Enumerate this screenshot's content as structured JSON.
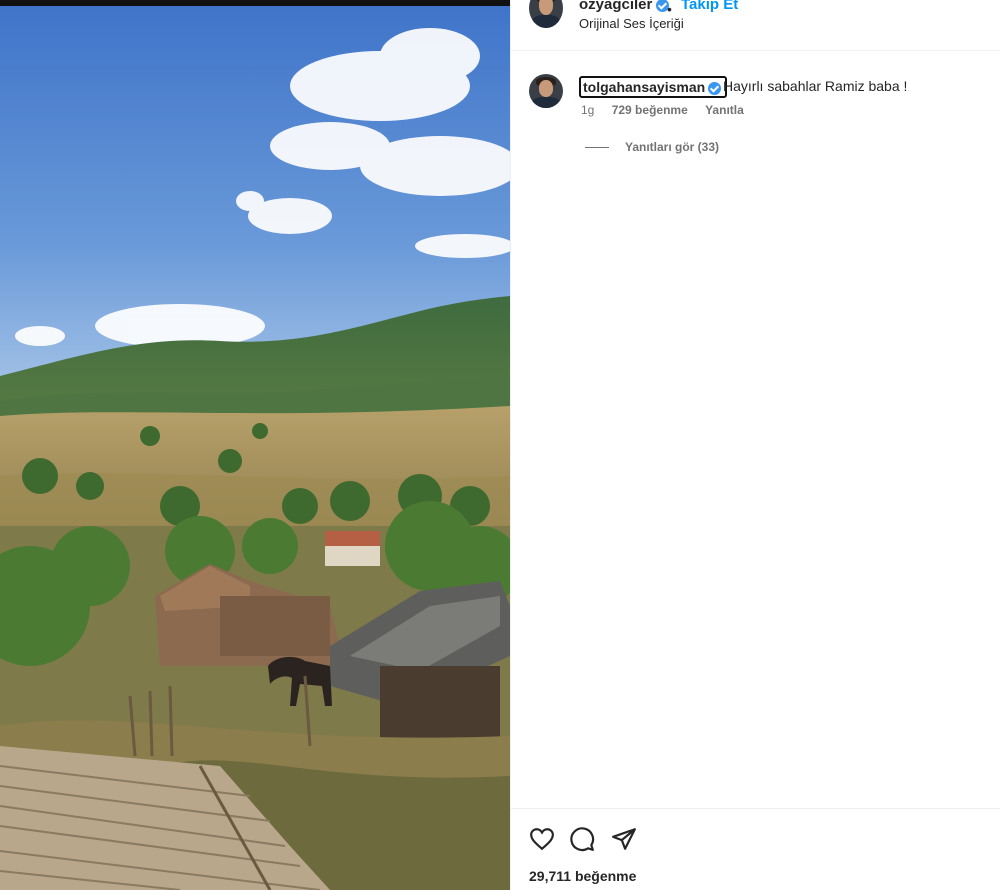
{
  "post": {
    "author": "ozyagciler",
    "follow_label": "Takip Et",
    "audio_label": "Orijinal Ses İçeriği",
    "likes_count": "29,711",
    "likes_word": "beğenme"
  },
  "comment": {
    "username": "tolgahansayisman",
    "text": "Hayırlı sabahlar Ramiz baba !",
    "time": "1g",
    "likes": "729 beğenme",
    "reply_label": "Yanıtla",
    "view_replies": "Yanıtları gör (33)"
  },
  "icons": [
    "heart-icon",
    "comment-icon",
    "share-icon",
    "verified-icon"
  ],
  "colors": {
    "accent": "#0095f6",
    "verified": "#3897f0",
    "text": "#262626",
    "muted": "#737373"
  }
}
